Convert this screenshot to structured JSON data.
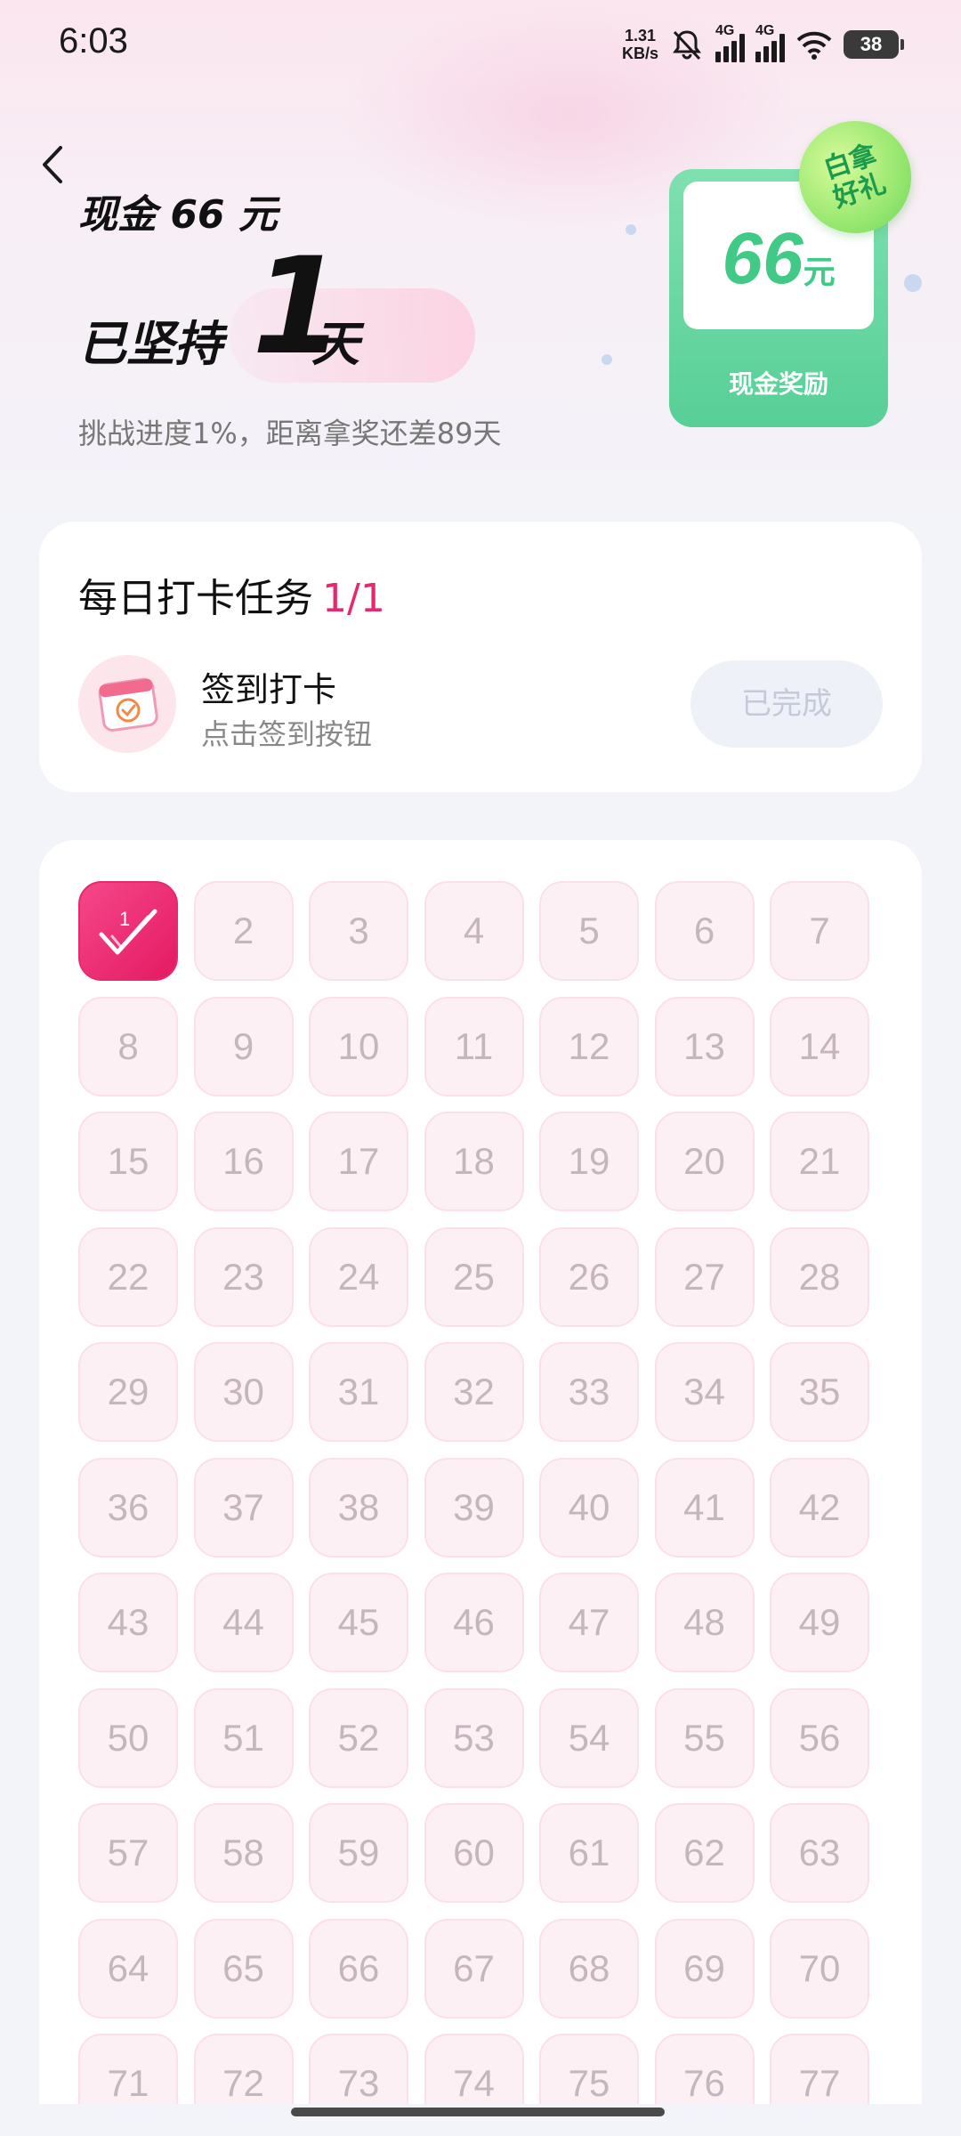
{
  "status_bar": {
    "time": "6:03",
    "speed_value": "1.31",
    "speed_unit": "KB/s",
    "network_1": "4G",
    "network_2": "4G",
    "battery": "38"
  },
  "header": {
    "cash_title": "现金 66 元",
    "persist_prefix": "已坚持",
    "persist_days": "1",
    "persist_suffix": "天",
    "progress_text": "挑战进度1%，距离拿奖还差89天"
  },
  "reward": {
    "badge_line1": "白拿",
    "badge_line2": "好礼",
    "amount": "66",
    "unit": "元",
    "label": "现金奖励"
  },
  "task": {
    "title": "每日打卡任务",
    "count": "1/1",
    "name": "签到打卡",
    "desc": "点击签到按钮",
    "button": "已完成"
  },
  "calendar": {
    "completed_days": [
      1
    ],
    "days": [
      "1",
      "2",
      "3",
      "4",
      "5",
      "6",
      "7",
      "8",
      "9",
      "10",
      "11",
      "12",
      "13",
      "14",
      "15",
      "16",
      "17",
      "18",
      "19",
      "20",
      "21",
      "22",
      "23",
      "24",
      "25",
      "26",
      "27",
      "28",
      "29",
      "30",
      "31",
      "32",
      "33",
      "34",
      "35",
      "36",
      "37",
      "38",
      "39",
      "40",
      "41",
      "42",
      "43",
      "44",
      "45",
      "46",
      "47",
      "48",
      "49",
      "50",
      "51",
      "52",
      "53",
      "54",
      "55",
      "56",
      "57",
      "58",
      "59",
      "60",
      "61",
      "62",
      "63",
      "64",
      "65",
      "66",
      "67",
      "68",
      "69",
      "70",
      "71",
      "72",
      "73",
      "74",
      "75",
      "76",
      "77"
    ]
  },
  "colors": {
    "accent_pink": "#e8286e",
    "reward_green": "#57cf96"
  }
}
